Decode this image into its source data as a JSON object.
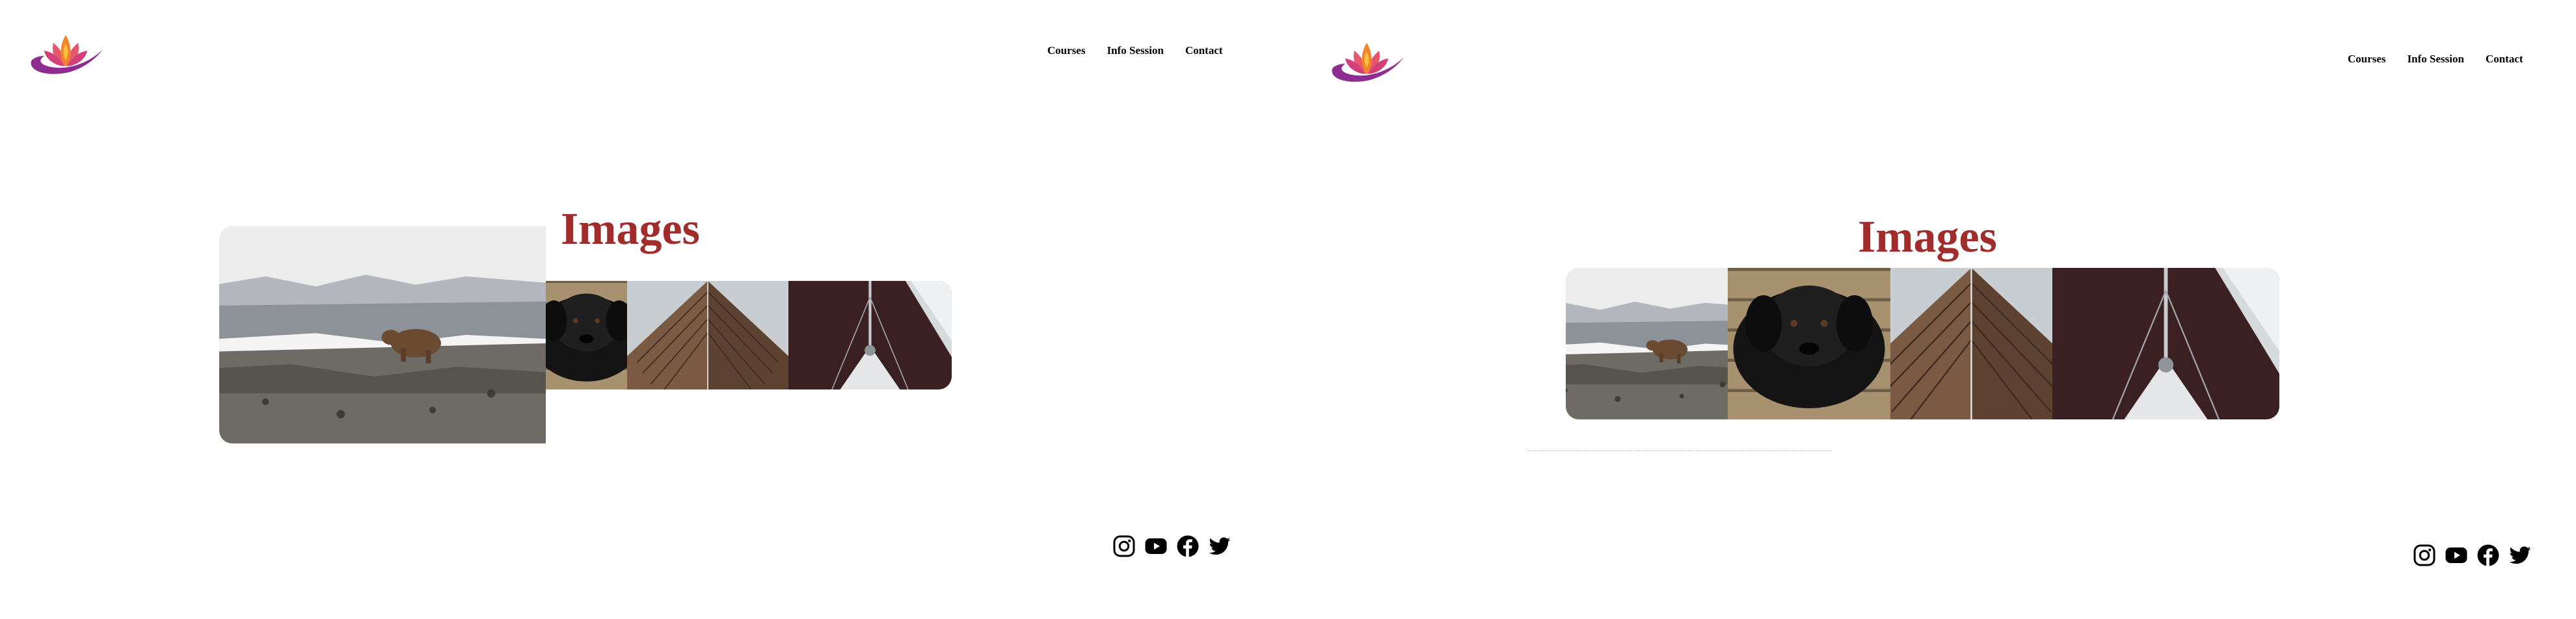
{
  "panels": [
    {
      "logo": {
        "alt": "Lotus logo"
      },
      "nav": {
        "courses": "Courses",
        "info_session": "Info Session",
        "contact": "Contact"
      },
      "heading": "Images",
      "gallery": [
        {
          "subject": "Bear on a snowy hillside",
          "state": "expanded"
        },
        {
          "subject": "Black dog on wooden floor",
          "state": "collapsed"
        },
        {
          "subject": "Modern building facade",
          "state": "collapsed"
        },
        {
          "subject": "Sailboat bow and mast",
          "state": "collapsed"
        }
      ],
      "social_icons": [
        "instagram-icon",
        "youtube-icon",
        "facebook-icon",
        "twitter-icon"
      ]
    },
    {
      "logo": {
        "alt": "Lotus logo"
      },
      "nav": {
        "courses": "Courses",
        "info_session": "Info Session",
        "contact": "Contact"
      },
      "heading": "Images",
      "gallery": [
        {
          "subject": "Bear on a snowy hillside",
          "state": "normal"
        },
        {
          "subject": "Black dog on wooden floor",
          "state": "hovered"
        },
        {
          "subject": "Modern building facade",
          "state": "normal"
        },
        {
          "subject": "Sailboat bow and mast",
          "state": "normal"
        }
      ],
      "social_icons": [
        "instagram-icon",
        "youtube-icon",
        "facebook-icon",
        "twitter-icon"
      ]
    }
  ],
  "colors": {
    "heading": "#a12c2c",
    "logo_purple": "#8e2c8f",
    "logo_orange": "#f0852d",
    "text": "#000000"
  }
}
